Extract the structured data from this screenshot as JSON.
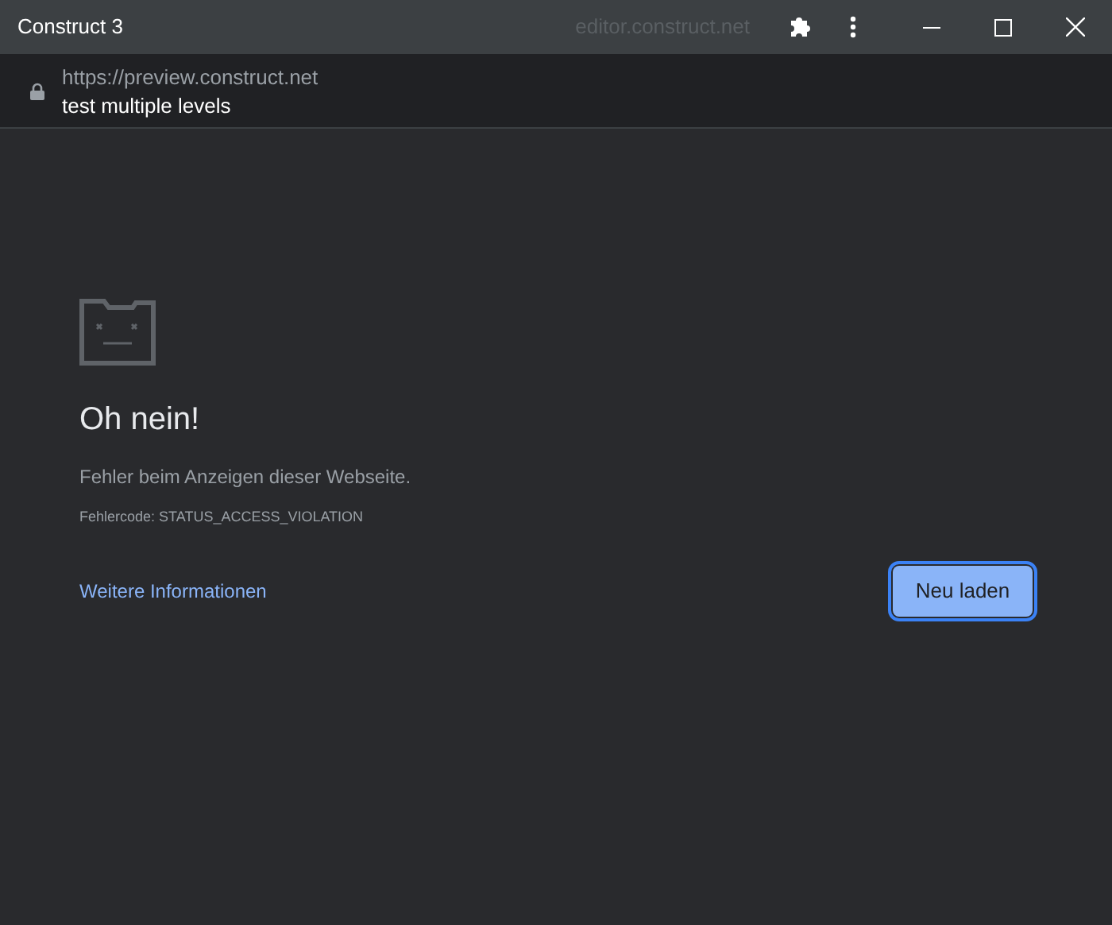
{
  "window": {
    "title": "Construct 3",
    "origin": "editor.construct.net"
  },
  "address_bar": {
    "url": "https://preview.construct.net",
    "page_title": "test multiple levels"
  },
  "error_page": {
    "heading": "Oh nein!",
    "message": "Fehler beim Anzeigen dieser Webseite.",
    "error_code": "Fehlercode: STATUS_ACCESS_VIOLATION",
    "more_info_link": "Weitere Informationen",
    "reload_button": {
      "label": "Neu laden",
      "focused": true
    }
  }
}
